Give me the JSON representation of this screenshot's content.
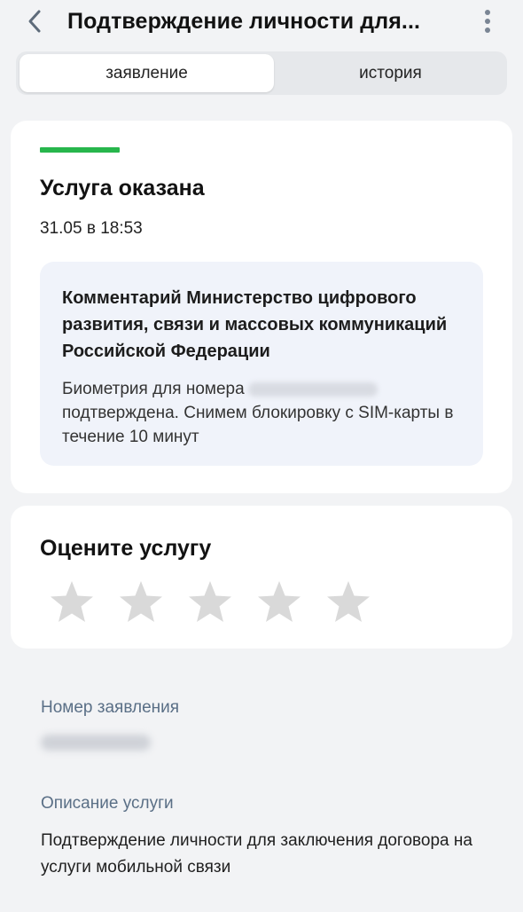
{
  "header": {
    "title": "Подтверждение личности для...",
    "back_icon": "chevron-left-icon",
    "menu_icon": "more-vertical-icon"
  },
  "tabs": [
    {
      "label": "заявление",
      "active": true
    },
    {
      "label": "история",
      "active": false
    }
  ],
  "status": {
    "title": "Услуга оказана",
    "date": "31.05 в 18:53",
    "accent_color": "#27b64c"
  },
  "comment": {
    "title": "Комментарий Министерство цифрового развития, связи и массовых коммуникаций Российской Федерации",
    "text_before": "Биометрия для номера",
    "text_after": "подтверждена. Снимем блокировку с SIM-карты в течение 10 минут"
  },
  "rating": {
    "title": "Оцените услугу",
    "max_stars": 5,
    "selected": 0,
    "star_color": "#d9d9d9"
  },
  "details": {
    "app_number_label": "Номер заявления",
    "description_label": "Описание услуги",
    "description_text": "Подтверждение личности для заключения договора на услуги мобильной связи"
  }
}
